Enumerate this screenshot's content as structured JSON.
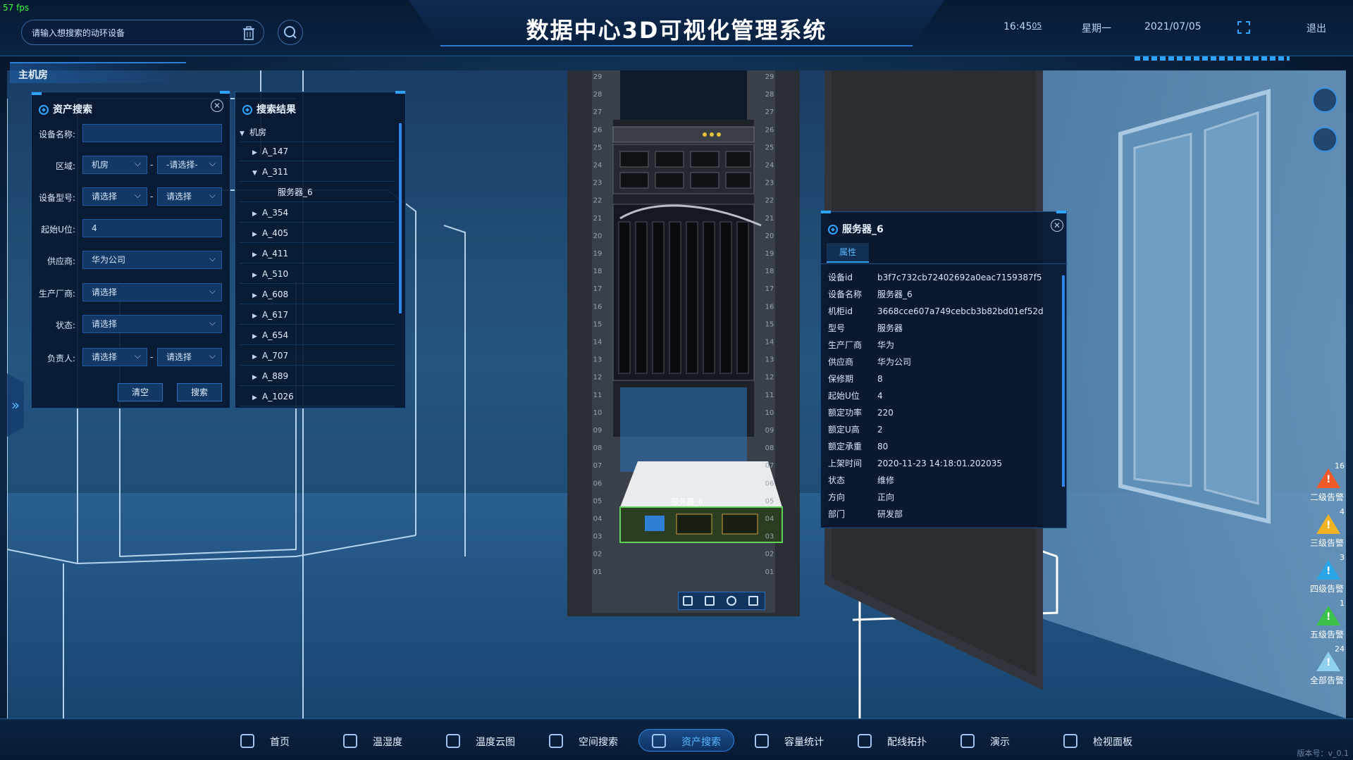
{
  "fps": "57 fps",
  "topbar": {
    "search_placeholder": "请输入想搜索的动环设备",
    "title": "数据中心3D可视化管理系统",
    "time": "16:45",
    "time_seconds": "05",
    "weekday": "星期一",
    "date": "2021/07/05",
    "logout": "退出"
  },
  "room_tab": "主机房",
  "asset_search": {
    "title": "资产搜索",
    "fields": {
      "device_name_label": "设备名称:",
      "device_name_value": "",
      "area_label": "区域:",
      "area_value": "机房",
      "area_value2": "-请选择-",
      "model_label": "设备型号:",
      "model_value": "请选择",
      "model_value2": "请选择",
      "start_u_label": "起始U位:",
      "start_u_value": "4",
      "supplier_label": "供应商:",
      "supplier_value": "华为公司",
      "manufacturer_label": "生产厂商:",
      "manufacturer_value": "请选择",
      "status_label": "状态:",
      "status_value": "请选择",
      "owner_label": "负责人:",
      "owner_value": "请选择",
      "owner_value2": "请选择",
      "dash": "-"
    },
    "clear_button": "清空",
    "search_button": "搜索"
  },
  "search_results": {
    "title": "搜索结果",
    "root": "机房",
    "items": [
      {
        "label": "A_147",
        "expanded": false
      },
      {
        "label": "A_311",
        "expanded": true
      },
      {
        "label": "服务器_6",
        "child": true
      },
      {
        "label": "A_354",
        "expanded": false
      },
      {
        "label": "A_405",
        "expanded": false
      },
      {
        "label": "A_411",
        "expanded": false
      },
      {
        "label": "A_510",
        "expanded": false
      },
      {
        "label": "A_608",
        "expanded": false
      },
      {
        "label": "A_617",
        "expanded": false
      },
      {
        "label": "A_654",
        "expanded": false
      },
      {
        "label": "A_707",
        "expanded": false
      },
      {
        "label": "A_889",
        "expanded": false
      },
      {
        "label": "A_1026",
        "expanded": false
      }
    ]
  },
  "rack": {
    "u_numbers": [
      "29",
      "28",
      "27",
      "26",
      "25",
      "24",
      "23",
      "22",
      "21",
      "20",
      "19",
      "18",
      "17",
      "16",
      "15",
      "14",
      "13",
      "12",
      "11",
      "10",
      "09",
      "08",
      "07",
      "06",
      "05",
      "04",
      "03",
      "02",
      "01"
    ],
    "server_label": "服务器_6"
  },
  "server_detail": {
    "title": "服务器_6",
    "tab": "属性",
    "props": [
      {
        "k": "设备id",
        "v": "b3f7c732cb72402692a0eac7159387f5"
      },
      {
        "k": "设备名称",
        "v": "服务器_6"
      },
      {
        "k": "机柜id",
        "v": "3668cce607a749cebcb3b82bd01ef52d"
      },
      {
        "k": "型号",
        "v": "服务器"
      },
      {
        "k": "生产厂商",
        "v": "华为"
      },
      {
        "k": "供应商",
        "v": "华为公司"
      },
      {
        "k": "保修期",
        "v": "8"
      },
      {
        "k": "起始U位",
        "v": "4"
      },
      {
        "k": "额定功率",
        "v": "220"
      },
      {
        "k": "额定U高",
        "v": "2"
      },
      {
        "k": "额定承重",
        "v": "80"
      },
      {
        "k": "上架时间",
        "v": "2020-11-23 14:18:01.202035"
      },
      {
        "k": "状态",
        "v": "维修"
      },
      {
        "k": "方向",
        "v": "正向"
      },
      {
        "k": "部门",
        "v": "研发部"
      }
    ]
  },
  "alarms": [
    {
      "count": "16",
      "label": "二级告警",
      "color": "#f05a28"
    },
    {
      "count": "4",
      "label": "三级告警",
      "color": "#f0b323"
    },
    {
      "count": "3",
      "label": "四级告警",
      "color": "#2aa6e8"
    },
    {
      "count": "1",
      "label": "五级告警",
      "color": "#3cc24a"
    },
    {
      "count": "24",
      "label": "全部告警",
      "color": "#8fd0ef"
    }
  ],
  "nav": [
    {
      "label": "首页",
      "icon": "home-icon"
    },
    {
      "label": "温湿度",
      "icon": "thermometer-icon"
    },
    {
      "label": "温度云图",
      "icon": "cloud-icon"
    },
    {
      "label": "空间搜索",
      "icon": "space-search-icon"
    },
    {
      "label": "资产搜索",
      "icon": "asset-search-icon",
      "active": true
    },
    {
      "label": "容量统计",
      "icon": "pie-chart-icon"
    },
    {
      "label": "配线拓扑",
      "icon": "topology-icon"
    },
    {
      "label": "演示",
      "icon": "presentation-icon"
    },
    {
      "label": "检视面板",
      "icon": "dashboard-icon"
    }
  ],
  "version": "版本号：v_0.1"
}
